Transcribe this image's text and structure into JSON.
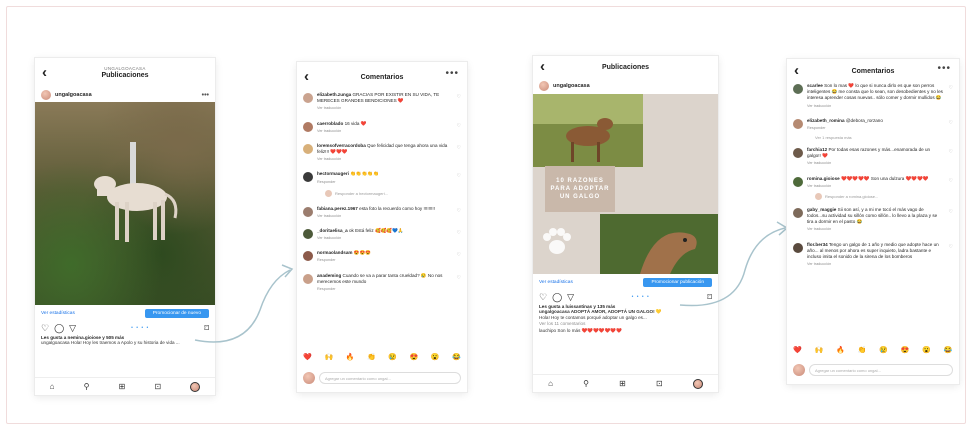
{
  "colors": {
    "accent": "#3897f0",
    "frame_border": "#f0dcdc",
    "heart": "#e0245e"
  },
  "screen1": {
    "top_subtitle": "UNGALGOACASA",
    "top_title": "Publicaciones",
    "username": "ungalgoacasa",
    "stats_link": "Ver estadísticas",
    "promo_button": "Promocionar de nuevo",
    "likes": "Les gusta a nemina.gioiose y 505 más",
    "caption": "ungalgoacasa Hola! Hoy les traemos a Apolo y su historia de vida ...",
    "icons": [
      "back-icon",
      "more-icon",
      "heart-icon",
      "comment-icon",
      "send-icon",
      "bookmark-icon",
      "home-icon",
      "search-icon",
      "add-icon",
      "shop-icon",
      "profile-icon"
    ]
  },
  "screen2": {
    "title": "Comentarios",
    "comments": [
      {
        "user": "elizabeth.zunga",
        "text": "GRACIAS POR EXISTIR EN SU VIDA, TE MERECES GRANDES BENDICIONES ❤️",
        "meta": "Ver traducción"
      },
      {
        "user": "caerroblado",
        "text": "16 vida ❤️",
        "meta": "Ver traducción"
      },
      {
        "user": "loremsofverracordoba",
        "text": "Que felicidad que tenga ahora una vida feliz!!! ❤️❤️❤️",
        "meta": "Ver traducción"
      },
      {
        "user": "hectormaugeri",
        "text": "👏👏👏👏👏",
        "meta": "Responder"
      },
      {
        "user": "fabiana.perez.1967",
        "text": "esta foto la recuerdo como hoy !!!!!!!!!",
        "meta": "Ver traducción"
      },
      {
        "user": "_doritaelisa_a",
        "text": "ok Está feliz 🥰🥰🥰💙🙏",
        "meta": "Ver traducción"
      },
      {
        "user": "normaolandsam",
        "text": "😍😍😍",
        "meta": "Responder"
      },
      {
        "user": "anademing",
        "text": "Cuando se va a parar tanta crueldad? 😢 No nos merecemos este mundo",
        "meta": "Responder"
      }
    ],
    "reply_text": "Responder a hectormaugeri...",
    "add_comment": "Agregar un comentario como ungal...",
    "emojis": [
      "❤️",
      "🙌",
      "🔥",
      "👏",
      "😢",
      "😍",
      "😮",
      "😂"
    ]
  },
  "screen3": {
    "top_title": "Publicaciones",
    "username": "ungalgoacasa",
    "collage_text": "10 RAZONES PARA ADOPTAR UN GALGO",
    "stats_link": "Ver estadísticas",
    "promo_button": "Promocionar publicación",
    "likes": "Les gusta a luissantinas y 135 más",
    "caption": "ungalgoacasa ADOPTÁ AMOR, ADOPTÁ UN GALGO! 💛",
    "caption2": "Hola! Hoy te contamos porqué adoptar un galgo es...",
    "view_comments": "Ver los 11 comentarios",
    "comment_line": "lauchipo Son lo más ❤️❤️❤️❤️❤️❤️❤️"
  },
  "screen4": {
    "title": "Comentarios",
    "comments": [
      {
        "user": "scarlee",
        "text": "Son lo mas ❤️ lo que si nunca dirlo es que son perros inteligentes 😂 me consta que lo sean, son desobedientes y no les interesa aprender cosas nuevas.. sólo comer y dormir mullidos 😂",
        "meta": "Ver traducción"
      },
      {
        "user": "elizabeth_romina",
        "text": "@debora_rorzano",
        "meta": "Responder"
      },
      {
        "user": "farchia12",
        "text": "Por todas esas razones y más...enamorada de un galgo!! ❤️",
        "meta": "Ver traducción"
      },
      {
        "user": "romina.gioiose",
        "text": "❤️❤️❤️❤️❤️ Son una dulzura ❤️❤️❤️❤️",
        "meta": "Ver traducción"
      },
      {
        "user": "gaby_maggie",
        "text": "Sii son así, y a mi me tocó el más vago de todos...su actividad su sillón como sillón.. lo llevo a la plaza y se tira a dormir en el pasto 😂",
        "meta": "Ver traducción"
      },
      {
        "user": "flor.ber34",
        "text": "Tengo un galgo de 1 año y medio que adopte hace un año... al menos por ahora es super inquieto, ladra bastante e incluso imita el sonido de la sirena de los bomberos",
        "meta": "Ver traducción"
      }
    ],
    "reply_line": "Ver 1 respuesta más",
    "reply_text": "Responder a romina.gioiose...",
    "add_comment": "Agregar un comentario como ungal...",
    "emojis": [
      "❤️",
      "🙌",
      "🔥",
      "👏",
      "😢",
      "😍",
      "😮",
      "😂"
    ]
  }
}
